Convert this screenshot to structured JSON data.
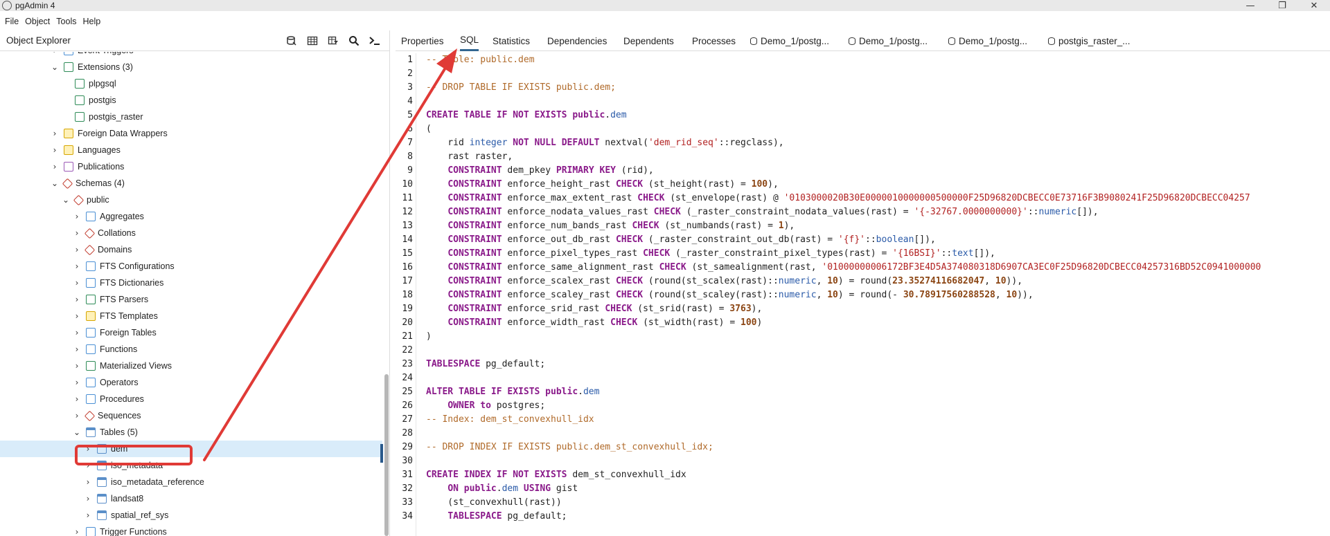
{
  "window": {
    "title": "pgAdmin 4",
    "controls": {
      "minimize": "—",
      "maximize": "❐",
      "close": "✕"
    }
  },
  "menu": [
    "File",
    "Object",
    "Tools",
    "Help"
  ],
  "object_explorer": {
    "title": "Object Explorer",
    "tree": [
      {
        "label": "Event Triggers",
        "chev": "›",
        "icon": "event-trigger",
        "indent": 1
      },
      {
        "label": "Extensions (3)",
        "chev": "⌄",
        "icon": "extension",
        "indent": 1
      },
      {
        "label": "plpgsql",
        "chev": "",
        "icon": "extension",
        "indent": 2
      },
      {
        "label": "postgis",
        "chev": "",
        "icon": "extension",
        "indent": 2
      },
      {
        "label": "postgis_raster",
        "chev": "",
        "icon": "extension",
        "indent": 2
      },
      {
        "label": "Foreign Data Wrappers",
        "chev": "›",
        "icon": "fdw",
        "indent": 1
      },
      {
        "label": "Languages",
        "chev": "›",
        "icon": "language",
        "indent": 1
      },
      {
        "label": "Publications",
        "chev": "›",
        "icon": "publication",
        "indent": 1
      },
      {
        "label": "Schemas (4)",
        "chev": "⌄",
        "icon": "schemas",
        "indent": 1
      },
      {
        "label": "public",
        "chev": "⌄",
        "icon": "schema",
        "indent": 2
      },
      {
        "label": "Aggregates",
        "chev": "›",
        "icon": "aggregate",
        "indent": 3
      },
      {
        "label": "Collations",
        "chev": "›",
        "icon": "collation",
        "indent": 3
      },
      {
        "label": "Domains",
        "chev": "›",
        "icon": "domain",
        "indent": 3
      },
      {
        "label": "FTS Configurations",
        "chev": "›",
        "icon": "fts-config",
        "indent": 3
      },
      {
        "label": "FTS Dictionaries",
        "chev": "›",
        "icon": "fts-dict",
        "indent": 3
      },
      {
        "label": "FTS Parsers",
        "chev": "›",
        "icon": "fts-parser",
        "indent": 3
      },
      {
        "label": "FTS Templates",
        "chev": "›",
        "icon": "fts-template",
        "indent": 3
      },
      {
        "label": "Foreign Tables",
        "chev": "›",
        "icon": "foreign-table",
        "indent": 3
      },
      {
        "label": "Functions",
        "chev": "›",
        "icon": "function",
        "indent": 3
      },
      {
        "label": "Materialized Views",
        "chev": "›",
        "icon": "mview",
        "indent": 3
      },
      {
        "label": "Operators",
        "chev": "›",
        "icon": "operator",
        "indent": 3
      },
      {
        "label": "Procedures",
        "chev": "›",
        "icon": "procedure",
        "indent": 3
      },
      {
        "label": "Sequences",
        "chev": "›",
        "icon": "sequence",
        "indent": 3
      },
      {
        "label": "Tables (5)",
        "chev": "⌄",
        "icon": "tables",
        "indent": 3
      },
      {
        "label": "dem",
        "chev": "›",
        "icon": "table",
        "indent": 4,
        "selected": true
      },
      {
        "label": "iso_metadata",
        "chev": "›",
        "icon": "table",
        "indent": 4
      },
      {
        "label": "iso_metadata_reference",
        "chev": "›",
        "icon": "table",
        "indent": 4
      },
      {
        "label": "landsat8",
        "chev": "›",
        "icon": "table",
        "indent": 4
      },
      {
        "label": "spatial_ref_sys",
        "chev": "›",
        "icon": "table",
        "indent": 4
      },
      {
        "label": "Trigger Functions",
        "chev": "›",
        "icon": "trigger-function",
        "indent": 3
      }
    ]
  },
  "tabs": [
    {
      "label": "Properties",
      "icon": ""
    },
    {
      "label": "SQL",
      "icon": "",
      "active": true
    },
    {
      "label": "Statistics",
      "icon": ""
    },
    {
      "label": "Dependencies",
      "icon": ""
    },
    {
      "label": "Dependents",
      "icon": ""
    },
    {
      "label": "Processes",
      "icon": ""
    },
    {
      "label": "Demo_1/postg...",
      "icon": "database"
    },
    {
      "label": "Demo_1/postg...",
      "icon": "database"
    },
    {
      "label": "Demo_1/postg...",
      "icon": "database"
    },
    {
      "label": "postgis_raster_...",
      "icon": "database"
    }
  ],
  "sql_lines": [
    [
      [
        "cm",
        "-- Table: public.dem"
      ]
    ],
    [],
    [
      [
        "cm",
        "-- DROP TABLE IF EXISTS public.dem;"
      ]
    ],
    [],
    [
      [
        "kw",
        "CREATE TABLE IF NOT EXISTS public"
      ],
      [
        "",
        "."
      ],
      [
        "tp",
        "dem"
      ]
    ],
    [
      [
        "",
        "("
      ]
    ],
    [
      [
        "",
        "    rid "
      ],
      [
        "tp",
        "integer"
      ],
      [
        "",
        " "
      ],
      [
        "kw",
        "NOT NULL DEFAULT"
      ],
      [
        "",
        " nextval("
      ],
      [
        "st",
        "'dem_rid_seq'"
      ],
      [
        "",
        "::regclass),"
      ]
    ],
    [
      [
        "",
        "    rast raster,"
      ]
    ],
    [
      [
        "",
        "    "
      ],
      [
        "kw",
        "CONSTRAINT"
      ],
      [
        "",
        " dem_pkey "
      ],
      [
        "kw",
        "PRIMARY KEY"
      ],
      [
        "",
        " (rid),"
      ]
    ],
    [
      [
        "",
        "    "
      ],
      [
        "kw",
        "CONSTRAINT"
      ],
      [
        "",
        " enforce_height_rast "
      ],
      [
        "kw",
        "CHECK"
      ],
      [
        "",
        " (st_height(rast) = "
      ],
      [
        "nm",
        "100"
      ],
      [
        "",
        "),"
      ]
    ],
    [
      [
        "",
        "    "
      ],
      [
        "kw",
        "CONSTRAINT"
      ],
      [
        "",
        " enforce_max_extent_rast "
      ],
      [
        "kw",
        "CHECK"
      ],
      [
        "",
        " (st_envelope(rast) @ "
      ],
      [
        "st",
        "'0103000020B30E0000010000000500000F25D96820DCBECC0E73716F3B9080241F25D96820DCBECC04257"
      ]
    ],
    [
      [
        "",
        "    "
      ],
      [
        "kw",
        "CONSTRAINT"
      ],
      [
        "",
        " enforce_nodata_values_rast "
      ],
      [
        "kw",
        "CHECK"
      ],
      [
        "",
        " (_raster_constraint_nodata_values(rast) = "
      ],
      [
        "st",
        "'{-32767.0000000000}'"
      ],
      [
        "",
        "::"
      ],
      [
        "tp",
        "numeric"
      ],
      [
        "",
        "[]),"
      ]
    ],
    [
      [
        "",
        "    "
      ],
      [
        "kw",
        "CONSTRAINT"
      ],
      [
        "",
        " enforce_num_bands_rast "
      ],
      [
        "kw",
        "CHECK"
      ],
      [
        "",
        " (st_numbands(rast) = "
      ],
      [
        "nm",
        "1"
      ],
      [
        "",
        "),"
      ]
    ],
    [
      [
        "",
        "    "
      ],
      [
        "kw",
        "CONSTRAINT"
      ],
      [
        "",
        " enforce_out_db_rast "
      ],
      [
        "kw",
        "CHECK"
      ],
      [
        "",
        " (_raster_constraint_out_db(rast) = "
      ],
      [
        "st",
        "'{f}'"
      ],
      [
        "",
        "::"
      ],
      [
        "tp",
        "boolean"
      ],
      [
        "",
        "[]),"
      ]
    ],
    [
      [
        "",
        "    "
      ],
      [
        "kw",
        "CONSTRAINT"
      ],
      [
        "",
        " enforce_pixel_types_rast "
      ],
      [
        "kw",
        "CHECK"
      ],
      [
        "",
        " (_raster_constraint_pixel_types(rast) = "
      ],
      [
        "st",
        "'{16BSI}'"
      ],
      [
        "",
        "::"
      ],
      [
        "tp",
        "text"
      ],
      [
        "",
        "[]),"
      ]
    ],
    [
      [
        "",
        "    "
      ],
      [
        "kw",
        "CONSTRAINT"
      ],
      [
        "",
        " enforce_same_alignment_rast "
      ],
      [
        "kw",
        "CHECK"
      ],
      [
        "",
        " (st_samealignment(rast, "
      ],
      [
        "st",
        "'01000000006172BF3E4D5A374080318D6907CA3EC0F25D96820DCBECC04257316BD52C0941000000"
      ]
    ],
    [
      [
        "",
        "    "
      ],
      [
        "kw",
        "CONSTRAINT"
      ],
      [
        "",
        " enforce_scalex_rast "
      ],
      [
        "kw",
        "CHECK"
      ],
      [
        "",
        " (round(st_scalex(rast)::"
      ],
      [
        "tp",
        "numeric"
      ],
      [
        ",",
        ""
      ],
      [
        "",
        ", "
      ],
      [
        "nm",
        "10"
      ],
      [
        "",
        ") = round("
      ],
      [
        "nm",
        "23.35274116682047"
      ],
      [
        "",
        ", "
      ],
      [
        "nm",
        "10"
      ],
      [
        "",
        "))"
      ],
      [
        "",
        ","
      ]
    ],
    [
      [
        "",
        "    "
      ],
      [
        "kw",
        "CONSTRAINT"
      ],
      [
        "",
        " enforce_scaley_rast "
      ],
      [
        "kw",
        "CHECK"
      ],
      [
        "",
        " (round(st_scaley(rast)::"
      ],
      [
        "tp",
        "numeric"
      ],
      [
        "",
        ", "
      ],
      [
        "nm",
        "10"
      ],
      [
        "",
        ") = round(- "
      ],
      [
        "nm",
        "30.78917560288528"
      ],
      [
        "",
        ", "
      ],
      [
        "nm",
        "10"
      ],
      [
        "",
        ")),"
      ]
    ],
    [
      [
        "",
        "    "
      ],
      [
        "kw",
        "CONSTRAINT"
      ],
      [
        "",
        " enforce_srid_rast "
      ],
      [
        "kw",
        "CHECK"
      ],
      [
        "",
        " (st_srid(rast) = "
      ],
      [
        "nm",
        "3763"
      ],
      [
        "",
        "),"
      ]
    ],
    [
      [
        "",
        "    "
      ],
      [
        "kw",
        "CONSTRAINT"
      ],
      [
        "",
        " enforce_width_rast "
      ],
      [
        "kw",
        "CHECK"
      ],
      [
        "",
        " (st_width(rast) = "
      ],
      [
        "nm",
        "100"
      ],
      [
        "",
        ")"
      ]
    ],
    [
      [
        "",
        ")"
      ]
    ],
    [],
    [
      [
        "kw",
        "TABLESPACE"
      ],
      [
        "",
        " pg_default;"
      ]
    ],
    [],
    [
      [
        "kw",
        "ALTER TABLE IF EXISTS public"
      ],
      [
        "",
        "."
      ],
      [
        "tp",
        "dem"
      ]
    ],
    [
      [
        "",
        "    "
      ],
      [
        "kw",
        "OWNER"
      ],
      [
        "",
        " "
      ],
      [
        "kw",
        "to"
      ],
      [
        "",
        " postgres;"
      ]
    ],
    [
      [
        "cm",
        "-- Index: dem_st_convexhull_idx"
      ]
    ],
    [],
    [
      [
        "cm",
        "-- DROP INDEX IF EXISTS public.dem_st_convexhull_idx;"
      ]
    ],
    [],
    [
      [
        "kw",
        "CREATE INDEX IF NOT EXISTS"
      ],
      [
        "",
        " dem_st_convexhull_idx"
      ]
    ],
    [
      [
        "",
        "    "
      ],
      [
        "kw",
        "ON public"
      ],
      [
        "",
        "."
      ],
      [
        "tp",
        "dem"
      ],
      [
        "",
        " "
      ],
      [
        "kw",
        "USING"
      ],
      [
        "",
        " gist"
      ]
    ],
    [
      [
        "",
        "    (st_convexhull(rast))"
      ]
    ],
    [
      [
        "",
        "    "
      ],
      [
        "kw",
        "TABLESPACE"
      ],
      [
        "",
        " pg_default;"
      ]
    ]
  ],
  "colors": {
    "annotation_red": "#e03a36",
    "selected_row": "#d9ecfa",
    "active_tab_underline": "#326690"
  }
}
